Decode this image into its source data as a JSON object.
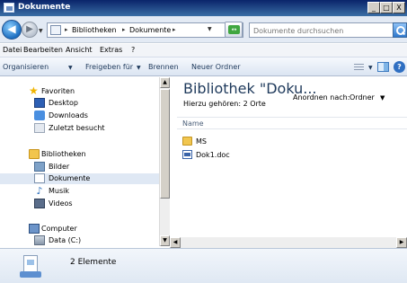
{
  "window": {
    "title": "Dokumente",
    "minimize": "_",
    "maximize": "□",
    "close": "X"
  },
  "navbar": {
    "back_glyph": "◀",
    "forward_glyph": "▶",
    "dropdown_glyph": "▼",
    "address_parts": [
      "Bibliotheken",
      "Dokumente"
    ],
    "address_separator": "▸",
    "refresh_glyph": "↔",
    "search_placeholder": "Dokumente durchsuchen"
  },
  "menubar": {
    "items": [
      "Datei",
      "Bearbeiten",
      "Ansicht",
      "Extras",
      "?"
    ]
  },
  "commandbar": {
    "organize": "Organisieren",
    "share": "Freigeben für",
    "burn": "Brennen",
    "new_folder": "Neuer Ordner",
    "dropdown_glyph": "▼",
    "help_glyph": "?"
  },
  "navpane": {
    "favorites": {
      "label": "Favoriten",
      "items": [
        "Desktop",
        "Downloads",
        "Zuletzt besucht"
      ]
    },
    "libraries": {
      "label": "Bibliotheken",
      "items": [
        "Bilder",
        "Dokumente",
        "Musik",
        "Videos"
      ],
      "selected": "Dokumente"
    },
    "computer": {
      "label": "Computer",
      "items": [
        "Data (C:)"
      ]
    }
  },
  "content": {
    "library_title": "Bibliothek \"Doku...",
    "includes": "Hierzu gehören: 2 Orte",
    "arrange_label": "Anordnen nach:",
    "arrange_value": "Ordner",
    "column_name": "Name",
    "files": [
      {
        "name": "MS",
        "type": "folder-icon"
      },
      {
        "name": "Dok1.doc",
        "type": "word-document-icon"
      }
    ]
  },
  "details": {
    "count_text": "2 Elemente"
  },
  "colors": {
    "titlebar": "#0a246a",
    "selection": "#dfe8f4",
    "link_text": "#1e395b"
  }
}
